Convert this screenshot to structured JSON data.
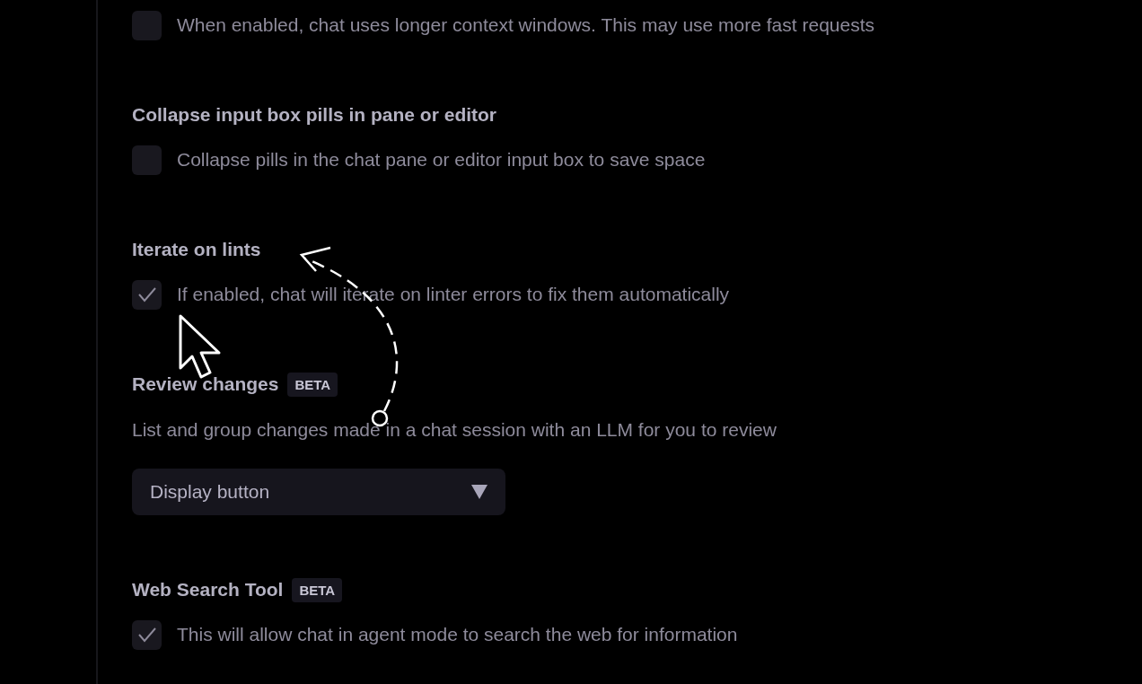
{
  "settings": [
    {
      "kind": "checkbox",
      "description": "When enabled, chat uses longer context windows. This may use more fast requests",
      "checked": false
    },
    {
      "kind": "checkbox",
      "title": "Collapse input box pills in pane or editor",
      "description": "Collapse pills in the chat pane or editor input box to save space",
      "checked": false
    },
    {
      "kind": "checkbox",
      "title": "Iterate on lints",
      "description": "If enabled, chat will iterate on linter errors to fix them automatically",
      "checked": true
    },
    {
      "kind": "select",
      "title": "Review changes",
      "badge": "BETA",
      "description": "List and group changes made in a chat session with an LLM for you to review",
      "value": "Display button"
    },
    {
      "kind": "checkbox",
      "title": "Web Search Tool",
      "badge": "BETA",
      "description": "This will allow chat in agent mode to search the web for information",
      "checked": true
    }
  ]
}
